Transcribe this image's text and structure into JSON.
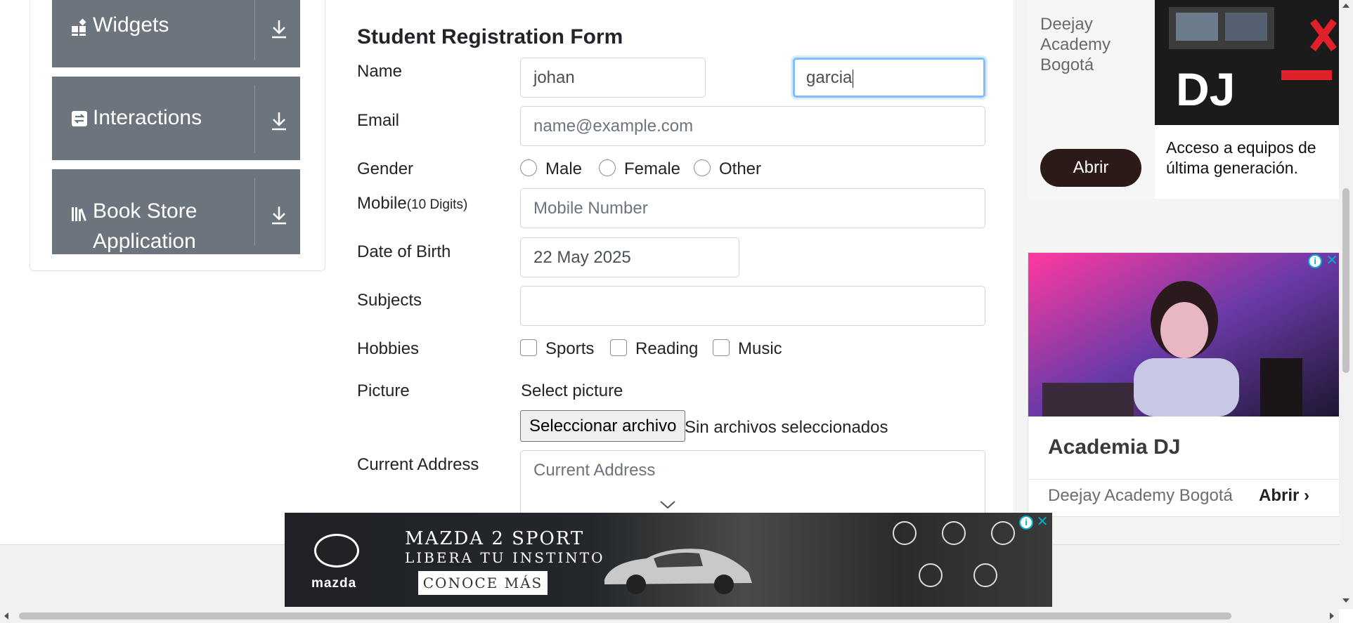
{
  "sidebar": {
    "items": [
      {
        "label": "Widgets",
        "icon": "widgets-icon"
      },
      {
        "label": "Interactions",
        "icon": "interactions-icon"
      },
      {
        "label": "Book Store",
        "label2": "Application",
        "icon": "book-icon"
      }
    ]
  },
  "form": {
    "title": "Student Registration Form",
    "name_label": "Name",
    "first_name": "johan",
    "last_name": "garcia",
    "email_label": "Email",
    "email_placeholder": "name@example.com",
    "gender_label": "Gender",
    "gender_options": [
      "Male",
      "Female",
      "Other"
    ],
    "mobile_label": "Mobile",
    "mobile_hint": "(10 Digits)",
    "mobile_placeholder": "Mobile Number",
    "dob_label": "Date of Birth",
    "dob_value": "22 May 2025",
    "subjects_label": "Subjects",
    "hobbies_label": "Hobbies",
    "hobbies_options": [
      "Sports",
      "Reading",
      "Music"
    ],
    "picture_label": "Picture",
    "picture_prompt": "Select picture",
    "file_button": "Seleccionar archivo",
    "file_status": "Sin archivos seleccionados",
    "address_label": "Current Address",
    "address_placeholder": "Current Address"
  },
  "ads": {
    "ad1": {
      "advertiser": "Deejay Academy Bogotá",
      "cta": "Abrir",
      "description": "Acceso a equipos de última generación."
    },
    "ad2": {
      "title": "Academia DJ",
      "advertiser": "Deejay Academy Bogotá",
      "cta": "Abrir"
    },
    "banner": {
      "brand": "mazda",
      "headline": "MAZDA 2 SPORT",
      "subheadline": "LIBERA TU INSTINTO",
      "cta": "CONOCE MÁS"
    }
  },
  "colors": {
    "sidebar_bg": "#6c757d",
    "focus_border": "#80bdff",
    "adchoices": "#00aecd"
  }
}
